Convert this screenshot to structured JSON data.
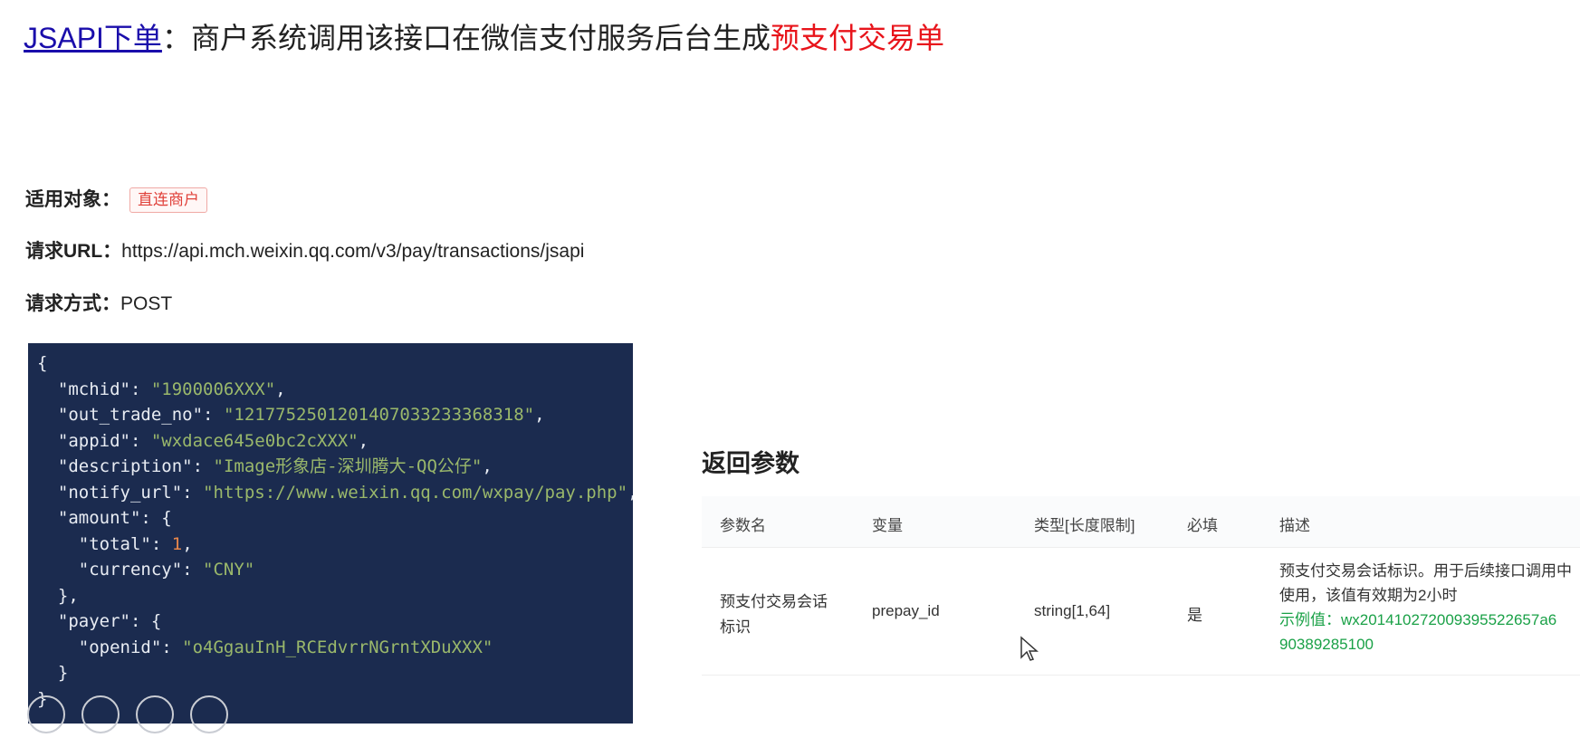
{
  "heading": {
    "link": "JSAPI下单",
    "text": "：商户系统调用该接口在微信支付服务后台生成",
    "highlight": "预支付交易单"
  },
  "meta": {
    "applicable_label": "适用对象：",
    "applicable_badge": "直连商户",
    "url_label": "请求URL：",
    "url_value": "https://api.mch.weixin.qq.com/v3/pay/transactions/jsapi",
    "method_label": "请求方式：",
    "method_value": "POST"
  },
  "code": {
    "mchid_key": "\"mchid\"",
    "mchid": "\"1900006XXX\"",
    "out_trade_no_key": "\"out_trade_no\"",
    "out_trade_no": "\"1217752501201407033233368318\"",
    "appid_key": "\"appid\"",
    "appid": "\"wxdace645e0bc2cXXX\"",
    "description_key": "\"description\"",
    "description": "\"Image形象店-深圳腾大-QQ公仔\"",
    "notify_url_key": "\"notify_url\"",
    "notify_url": "\"https://www.weixin.qq.com/wxpay/pay.php\"",
    "amount_key": "\"amount\"",
    "total_key": "\"total\"",
    "total": "1",
    "currency_key": "\"currency\"",
    "currency": "\"CNY\"",
    "payer_key": "\"payer\"",
    "openid_key": "\"openid\"",
    "openid": "\"o4GgauInH_RCEdvrrNGrntXDuXXX\""
  },
  "returns": {
    "title": "返回参数",
    "headers": [
      "参数名",
      "变量",
      "类型[长度限制]",
      "必填",
      "描述"
    ],
    "row": {
      "name_line1": "预支付交易会话",
      "name_line2": "标识",
      "variable": "prepay_id",
      "type": "string[1,64]",
      "required": "是",
      "desc_line1": "预支付交易会话标识。用于后续接口调用中",
      "desc_line2": "使用，该值有效期为2小时",
      "example_line1": "示例值：wx201410272009395522657a6",
      "example_line2": "90389285100"
    }
  },
  "colors": {
    "link": "#1a0dab",
    "highlight": "#e8141b",
    "code_bg": "#1b2b4f",
    "code_string": "#9ab86b",
    "code_number": "#e8874b",
    "example_green": "#1aa147"
  }
}
